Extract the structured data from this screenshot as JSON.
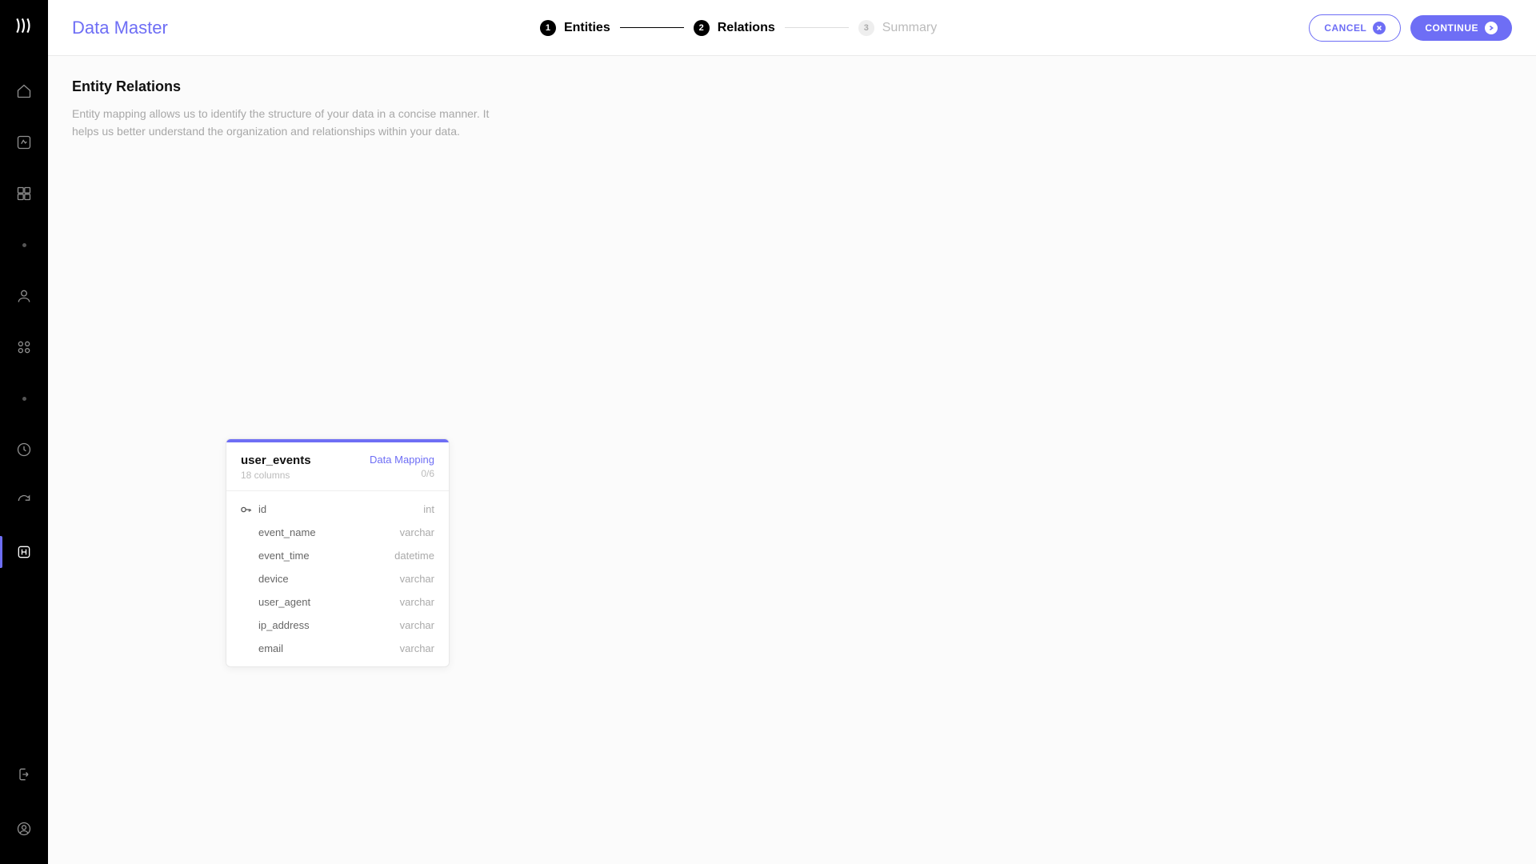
{
  "app": {
    "title": "Data Master"
  },
  "stepper": {
    "steps": [
      {
        "num": "1",
        "label": "Entities",
        "state": "done"
      },
      {
        "num": "2",
        "label": "Relations",
        "state": "current"
      },
      {
        "num": "3",
        "label": "Summary",
        "state": "pending"
      }
    ]
  },
  "actions": {
    "cancel": "CANCEL",
    "continue": "CONTINUE"
  },
  "section": {
    "title": "Entity Relations",
    "desc": "Entity mapping allows us to identify the structure of your data in a concise manner. It helps us better understand the organization and relationships within your data."
  },
  "entity": {
    "name": "user_events",
    "subtitle": "18 columns",
    "mapping_label": "Data Mapping",
    "mapping_sub": "0/6",
    "columns": [
      {
        "name": "id",
        "type": "int",
        "key": true
      },
      {
        "name": "event_name",
        "type": "varchar",
        "key": false
      },
      {
        "name": "event_time",
        "type": "datetime",
        "key": false
      },
      {
        "name": "device",
        "type": "varchar",
        "key": false
      },
      {
        "name": "user_agent",
        "type": "varchar",
        "key": false
      },
      {
        "name": "ip_address",
        "type": "varchar",
        "key": false
      },
      {
        "name": "email",
        "type": "varchar",
        "key": false
      }
    ]
  }
}
